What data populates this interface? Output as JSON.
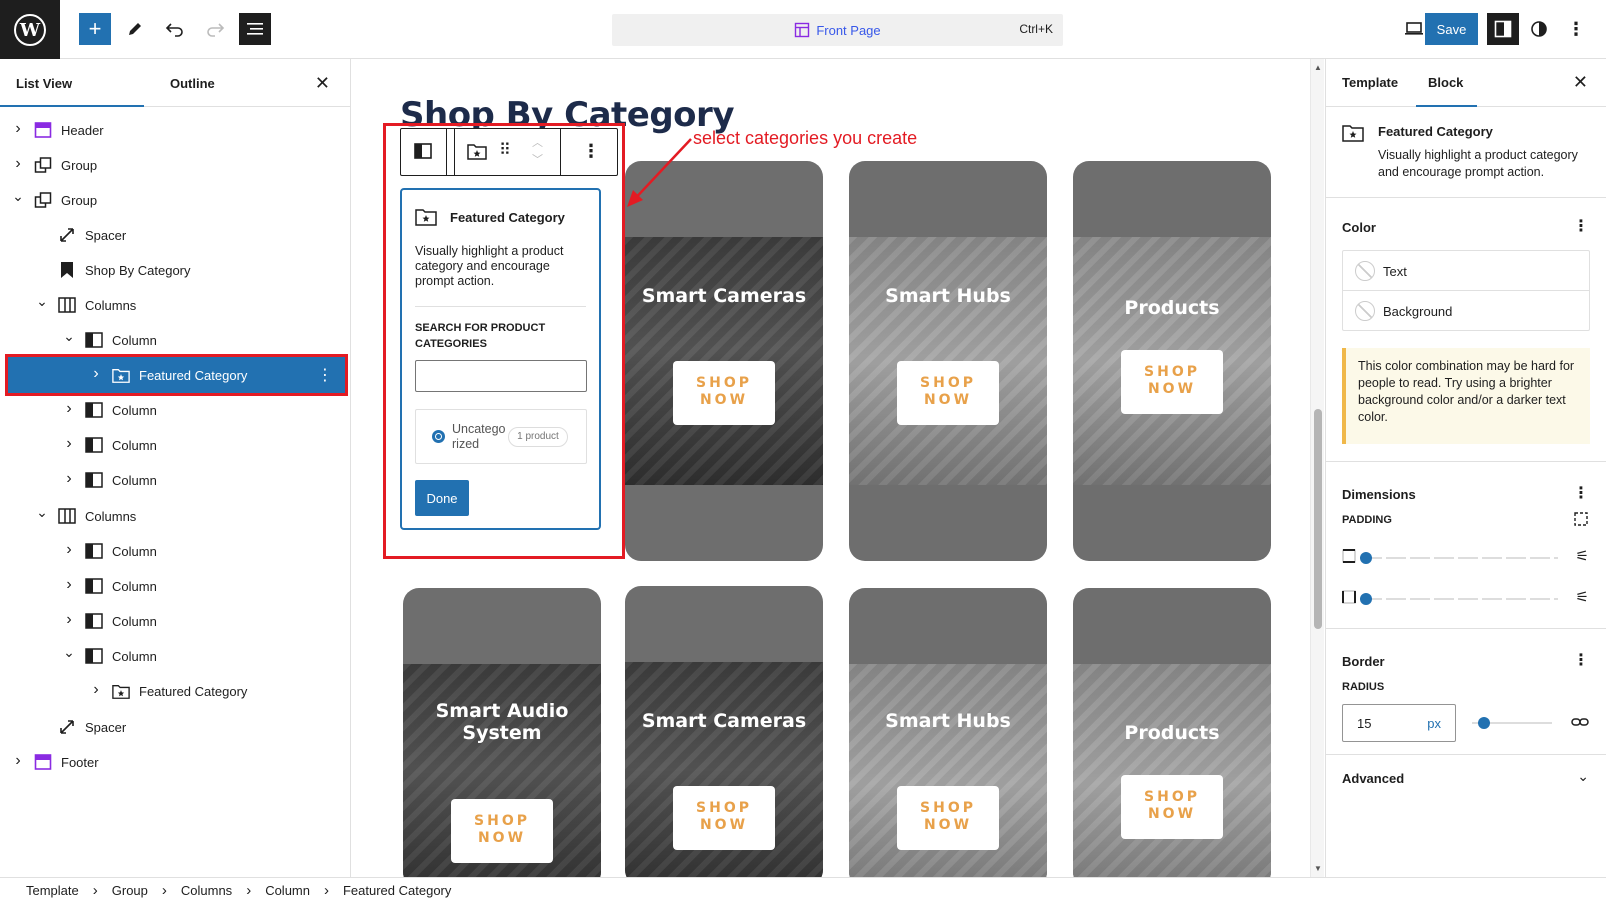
{
  "topbar": {
    "command_title": "Front Page",
    "command_shortcut": "Ctrl+K",
    "save_label": "Save"
  },
  "left_panel": {
    "tabs": [
      "List View",
      "Outline"
    ],
    "tree": [
      {
        "label": "Header",
        "icon": "template-part-icon",
        "depth": 0,
        "expanded": false
      },
      {
        "label": "Group",
        "icon": "group-icon",
        "depth": 0,
        "expanded": false
      },
      {
        "label": "Group",
        "icon": "group-icon",
        "depth": 0,
        "expanded": true
      },
      {
        "label": "Spacer",
        "icon": "spacer-icon",
        "depth": 1,
        "expanded": null
      },
      {
        "label": "Shop By Category",
        "icon": "bookmark-icon",
        "depth": 1,
        "expanded": null
      },
      {
        "label": "Columns",
        "icon": "columns-icon",
        "depth": 1,
        "expanded": true
      },
      {
        "label": "Column",
        "icon": "column-icon",
        "depth": 2,
        "expanded": true
      },
      {
        "label": "Featured Category",
        "icon": "folder-star-icon",
        "depth": 3,
        "expanded": false,
        "selected": true
      },
      {
        "label": "Column",
        "icon": "column-icon",
        "depth": 2,
        "expanded": false
      },
      {
        "label": "Column",
        "icon": "column-icon",
        "depth": 2,
        "expanded": false
      },
      {
        "label": "Column",
        "icon": "column-icon",
        "depth": 2,
        "expanded": false
      },
      {
        "label": "Columns",
        "icon": "columns-icon",
        "depth": 1,
        "expanded": true
      },
      {
        "label": "Column",
        "icon": "column-icon",
        "depth": 2,
        "expanded": false
      },
      {
        "label": "Column",
        "icon": "column-icon",
        "depth": 2,
        "expanded": false
      },
      {
        "label": "Column",
        "icon": "column-icon",
        "depth": 2,
        "expanded": false
      },
      {
        "label": "Column",
        "icon": "column-icon",
        "depth": 2,
        "expanded": true
      },
      {
        "label": "Featured Category",
        "icon": "folder-star-icon",
        "depth": 3,
        "expanded": false
      },
      {
        "label": "Spacer",
        "icon": "spacer-icon",
        "depth": 1,
        "expanded": null
      },
      {
        "label": "Footer",
        "icon": "template-part-icon",
        "depth": 0,
        "expanded": false
      }
    ]
  },
  "canvas": {
    "heading": "Shop By Category",
    "annotation": "select categories you create",
    "shop_label": "SHOP NOW",
    "row1": [
      "Smart Cameras",
      "Smart Hubs",
      "Products"
    ],
    "row2": [
      "Smart Audio System",
      "Smart Cameras",
      "Smart Hubs",
      "Products"
    ]
  },
  "popover": {
    "title": "Featured Category",
    "description": "Visually highlight a product category and encourage prompt action.",
    "search_label": "Search for product categories",
    "search_value": "",
    "option_label": "Uncategorized",
    "option_count": "1 product",
    "done_label": "Done"
  },
  "right_panel": {
    "tabs": [
      "Template",
      "Block"
    ],
    "block_title": "Featured Category",
    "block_description": "Visually highlight a product category and encourage prompt action.",
    "color_heading": "Color",
    "color_text": "Text",
    "color_background": "Background",
    "warning": "This color combination may be hard for people to read. Try using a brighter background color and/or a darker text color.",
    "dimensions_heading": "Dimensions",
    "padding_label": "PADDING",
    "padding_vertical": 0,
    "padding_horizontal": 0,
    "border_heading": "Border",
    "radius_label": "RADIUS",
    "radius_value": "15",
    "radius_unit": "px",
    "radius_fraction": 0.08,
    "advanced_heading": "Advanced"
  },
  "breadcrumb": [
    "Template",
    "Group",
    "Columns",
    "Column",
    "Featured Category"
  ],
  "colors": {
    "accent": "#2271b1",
    "annotation_red": "#e31b23",
    "shop_now_orange": "#e8a14a",
    "heading_navy": "#1d2b4a",
    "card_gray": "#6e6e6e"
  }
}
